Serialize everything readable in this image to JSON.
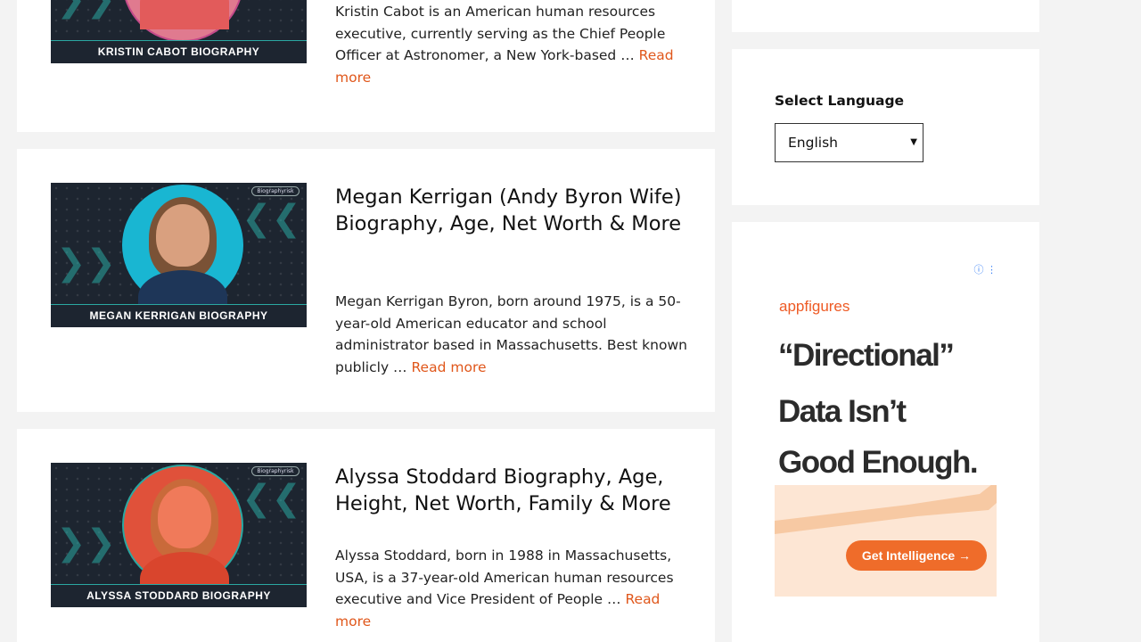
{
  "posts": [
    {
      "caption": "KRISTIN CABOT BIOGRAPHY",
      "excerpt": "Kristin Cabot is an American human resources executive, currently serving as the Chief People Officer at Astronomer, a New York-based … ",
      "read_more": "Read more"
    },
    {
      "title": "Megan Kerrigan (Andy Byron Wife) Biography, Age, Net Worth & More",
      "caption": "MEGAN KERRIGAN BIOGRAPHY",
      "excerpt": "Megan Kerrigan Byron, born around 1975, is a 50-year-old American educator and school administrator based in Massachusetts. Best known publicly … ",
      "read_more": "Read more"
    },
    {
      "title": "Alyssa Stoddard Biography, Age, Height, Net Worth, Family & More",
      "caption": "ALYSSA STODDARD BIOGRAPHY",
      "excerpt": "Alyssa Stoddard, born in 1988 in Massachusetts, USA, is a 37-year-old American human resources executive and Vice President of People … ",
      "read_more": "Read more"
    }
  ],
  "thumb_logo": "Biographyrisk",
  "sidebar": {
    "language_label": "Select Language",
    "language_value": "English"
  },
  "ad": {
    "brand": "appfigures",
    "headline_1": "“Directional”",
    "headline_2": "Data Isn’t",
    "headline_3": "Good Enough.",
    "cta": "Get Intelligence →",
    "icons": "ⓘ ⋮"
  },
  "colors": {
    "accent": "#e0571b",
    "thumb_bg": "#1d2530",
    "thumb_teal": "#2aa8a2",
    "ad_orange": "#ef6c2a"
  }
}
